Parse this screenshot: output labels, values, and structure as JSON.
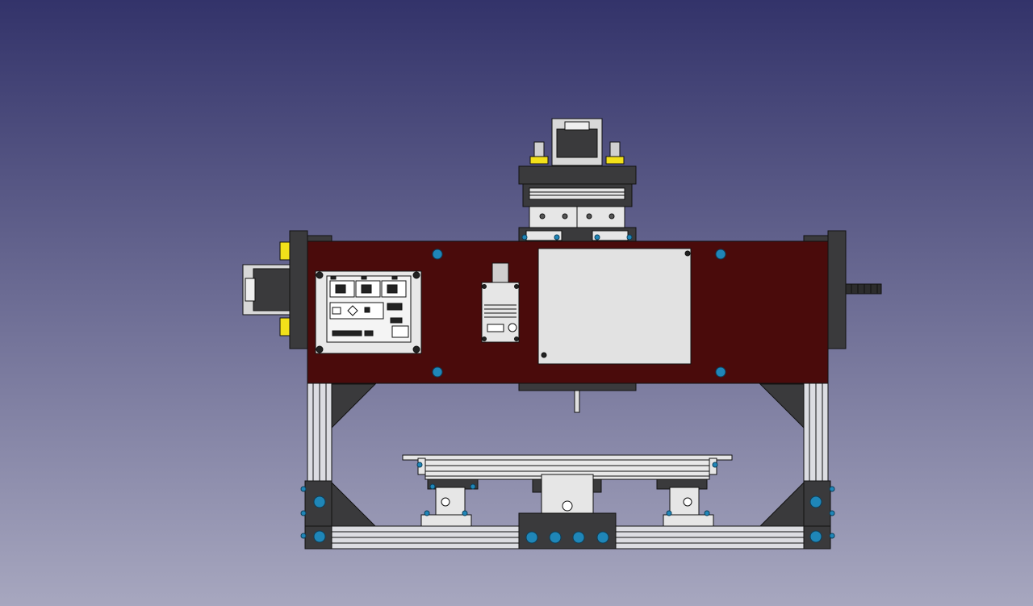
{
  "scene": {
    "description_free": true,
    "colors": {
      "background_top": "#33336a",
      "background_bottom": "#a7a7bf",
      "frame_panel": "#4a0b0b",
      "extrusion": "#dcdde2",
      "bracket_dark": "#3a3a3c",
      "steel": "#d8d8d8",
      "bolt_blue": "#1f86b8",
      "bearing_yellow": "#f2e01a",
      "outline": "#111111"
    },
    "icons": {
      "controller_board": "pcb-icon",
      "spindle_motor": "spindle-icon",
      "stepper_motor": "stepper-motor-icon",
      "bolt": "bolt-icon",
      "lead_screw": "lead-screw-icon"
    }
  }
}
